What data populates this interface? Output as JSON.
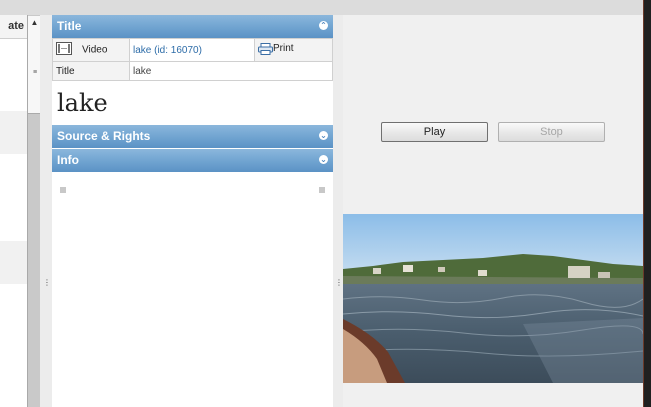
{
  "list": {
    "column_header": "ate"
  },
  "title_section": {
    "header": "Title",
    "rows": [
      {
        "icon": "filmstrip-icon",
        "key": "Video",
        "value": "lake (id: 16070)",
        "action_icon": "printer-icon",
        "action": "Print"
      },
      {
        "key": "Title",
        "value": "lake"
      }
    ],
    "display_title": "lake"
  },
  "sections": [
    {
      "label": "Source & Rights"
    },
    {
      "label": "Info"
    }
  ],
  "player": {
    "play_label": "Play",
    "stop_label": "Stop"
  },
  "colors": {
    "header_blue": "#6fa3d0",
    "link": "#2d6ca8"
  }
}
